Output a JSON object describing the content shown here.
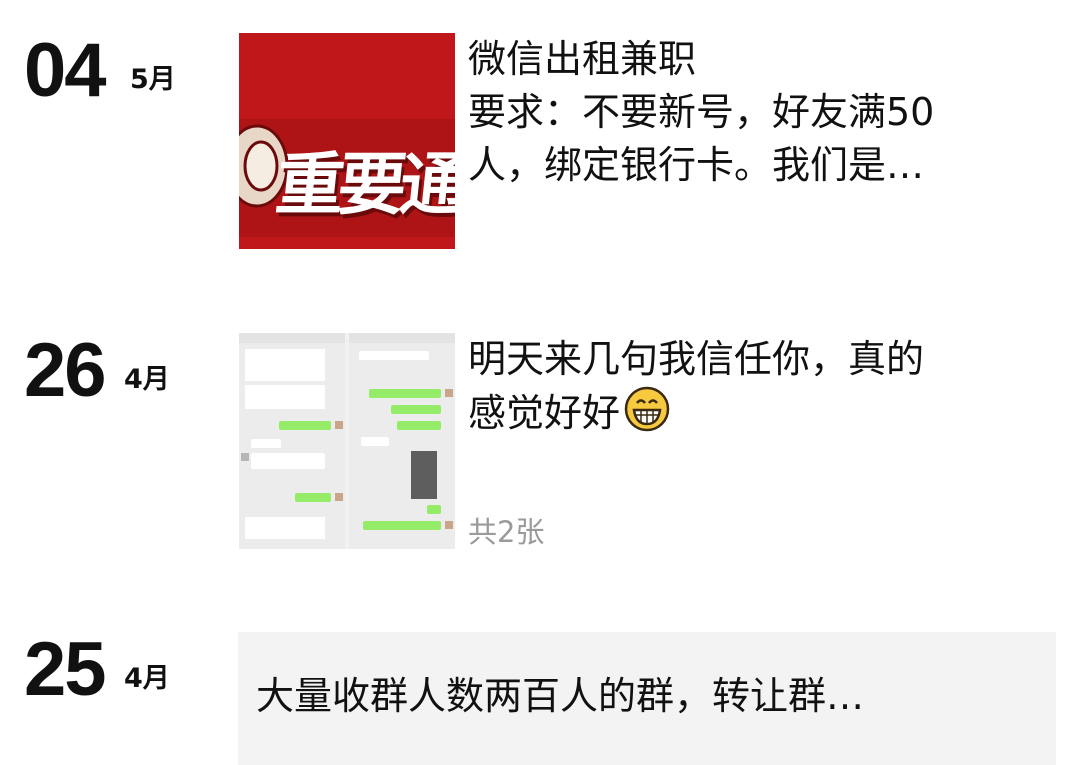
{
  "posts": [
    {
      "day": "04",
      "month": "5月",
      "thumbnail": {
        "text": "重要通"
      },
      "text_line1": "微信出租兼职",
      "text_line2": "要求：不要新号，好友满50",
      "text_line3": "人，绑定银行卡。我们是…"
    },
    {
      "day": "26",
      "month": "4月",
      "text_line1": "明天来几句我信任你，真的",
      "text_line2": "感觉好好",
      "emoji": "grinning-face",
      "image_count": "共2张"
    },
    {
      "day": "25",
      "month": "4月",
      "text_line1": "大量收群人数两百人的群，转让群…"
    }
  ],
  "colors": {
    "red_thumb": "#c0181a",
    "green_bubble": "#95ec69",
    "card_bg": "#f3f3f3",
    "count_gray": "#9a9a9a"
  }
}
